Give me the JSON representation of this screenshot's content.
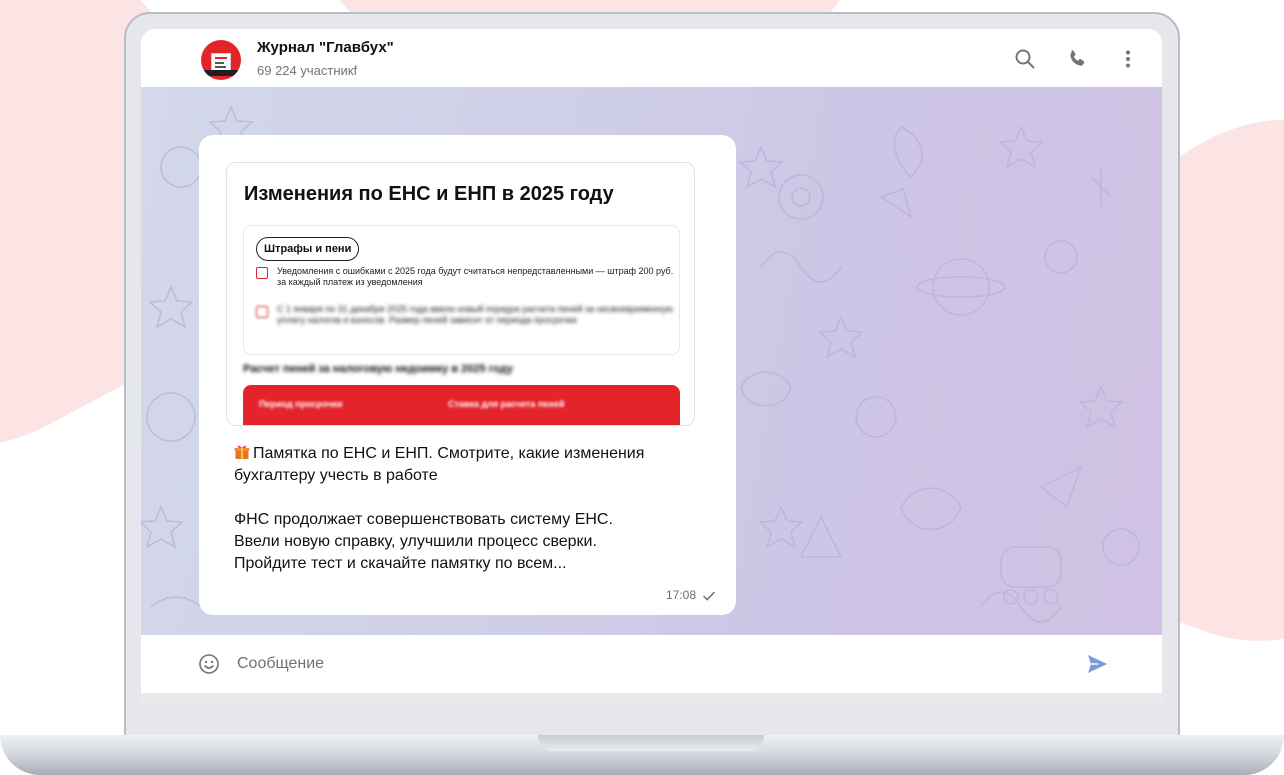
{
  "channel": {
    "title": "Журнал \"Главбух\"",
    "subtitle": "69 224 участникf"
  },
  "header_icons": [
    "search-icon",
    "phone-icon",
    "more-vertical-icon"
  ],
  "message": {
    "media": {
      "title": "Изменения по ЕНС и ЕНП в 2025 году",
      "pill": "Штрафы и пени",
      "item1": "Уведомления с ошибками с 2025 года будут считаться непредставленными — штраф 200 руб. за каждый платеж из уведомления",
      "item2": "С 1 января по 31 декабря 2025 года ввели новый порядок расчета пеней за несвоевременную уплату налогов и взносов. Размер пеней зависит от периода просрочки",
      "table_heading": "Расчет пеней за налоговую недоимку в 2025 году",
      "table_col1": "Период просрочки",
      "table_col2": "Ставка для расчета пеней"
    },
    "headline": "Памятка по ЕНС и ЕНП. Смотрите, какие изменения бухгалтеру учесть в работе",
    "body_lines": [
      "ФНС продолжает совершенствовать систему ЕНС.",
      "Ввели новую справку, улучшили процесс сверки.",
      "Пройдите тест и скачайте памятку по всем..."
    ],
    "time": "17:08",
    "status": "sent-check"
  },
  "composer": {
    "placeholder": "Сообщение"
  },
  "colors": {
    "accent_red": "#e4242b",
    "send_blue": "#7a9bd6",
    "page_pink": "#fde4e4"
  }
}
